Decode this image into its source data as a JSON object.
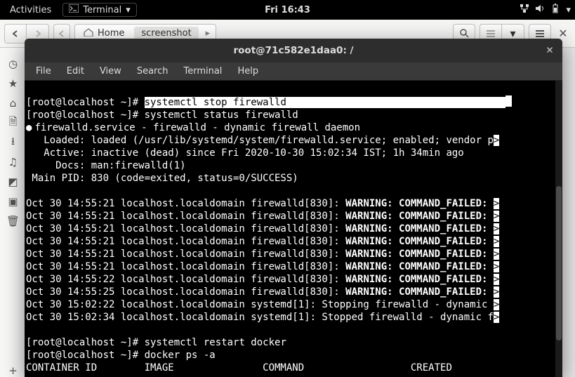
{
  "topbar": {
    "activities": "Activities",
    "app_name": "Terminal",
    "clock": "Fri 16:43"
  },
  "files": {
    "home_label": "Home",
    "breadcrumb_last": "screenshot"
  },
  "term": {
    "title": "root@71c582e1daa0: /",
    "menu": [
      "File",
      "Edit",
      "View",
      "Search",
      "Terminal",
      "Help"
    ],
    "prompt": "[root@localhost ~]# ",
    "cmd_stop": "systemctl stop firewalld",
    "cmd_status": "systemctl status firewalld",
    "svc_header": "firewalld.service - firewalld - dynamic firewall daemon",
    "svc_loaded": "   Loaded: loaded (/usr/lib/systemd/system/firewalld.service; enabled; vendor p",
    "svc_active": "   Active: inactive (dead) since Fri 2020-10-30 15:02:34 IST; 1h 34min ago",
    "svc_docs": "     Docs: man:firewalld(1)",
    "svc_pid": " Main PID: 830 (code=exited, status=0/SUCCESS)",
    "log_prefix_a": "Oct 30 14:55:21 localhost.localdomain firewalld[830]: ",
    "log_prefix_b": "Oct 30 14:55:22 localhost.localdomain firewalld[830]: ",
    "log_prefix_c": "Oct 30 14:55:25 localhost.localdomain firewalld[830]: ",
    "log_warn": "WARNING: COMMAND_FAILED: ",
    "log_sys_stop": "Oct 30 15:02:22 localhost.localdomain systemd[1]: Stopping firewalld - dynamic ",
    "log_sys_stopped": "Oct 30 15:02:34 localhost.localdomain systemd[1]: Stopped firewalld - dynamic f",
    "cmd_restart": "systemctl restart docker",
    "cmd_ps": "docker ps -a",
    "ps_header": "CONTAINER ID        IMAGE               COMMAND                  CREATED      ",
    "gt": ">"
  }
}
